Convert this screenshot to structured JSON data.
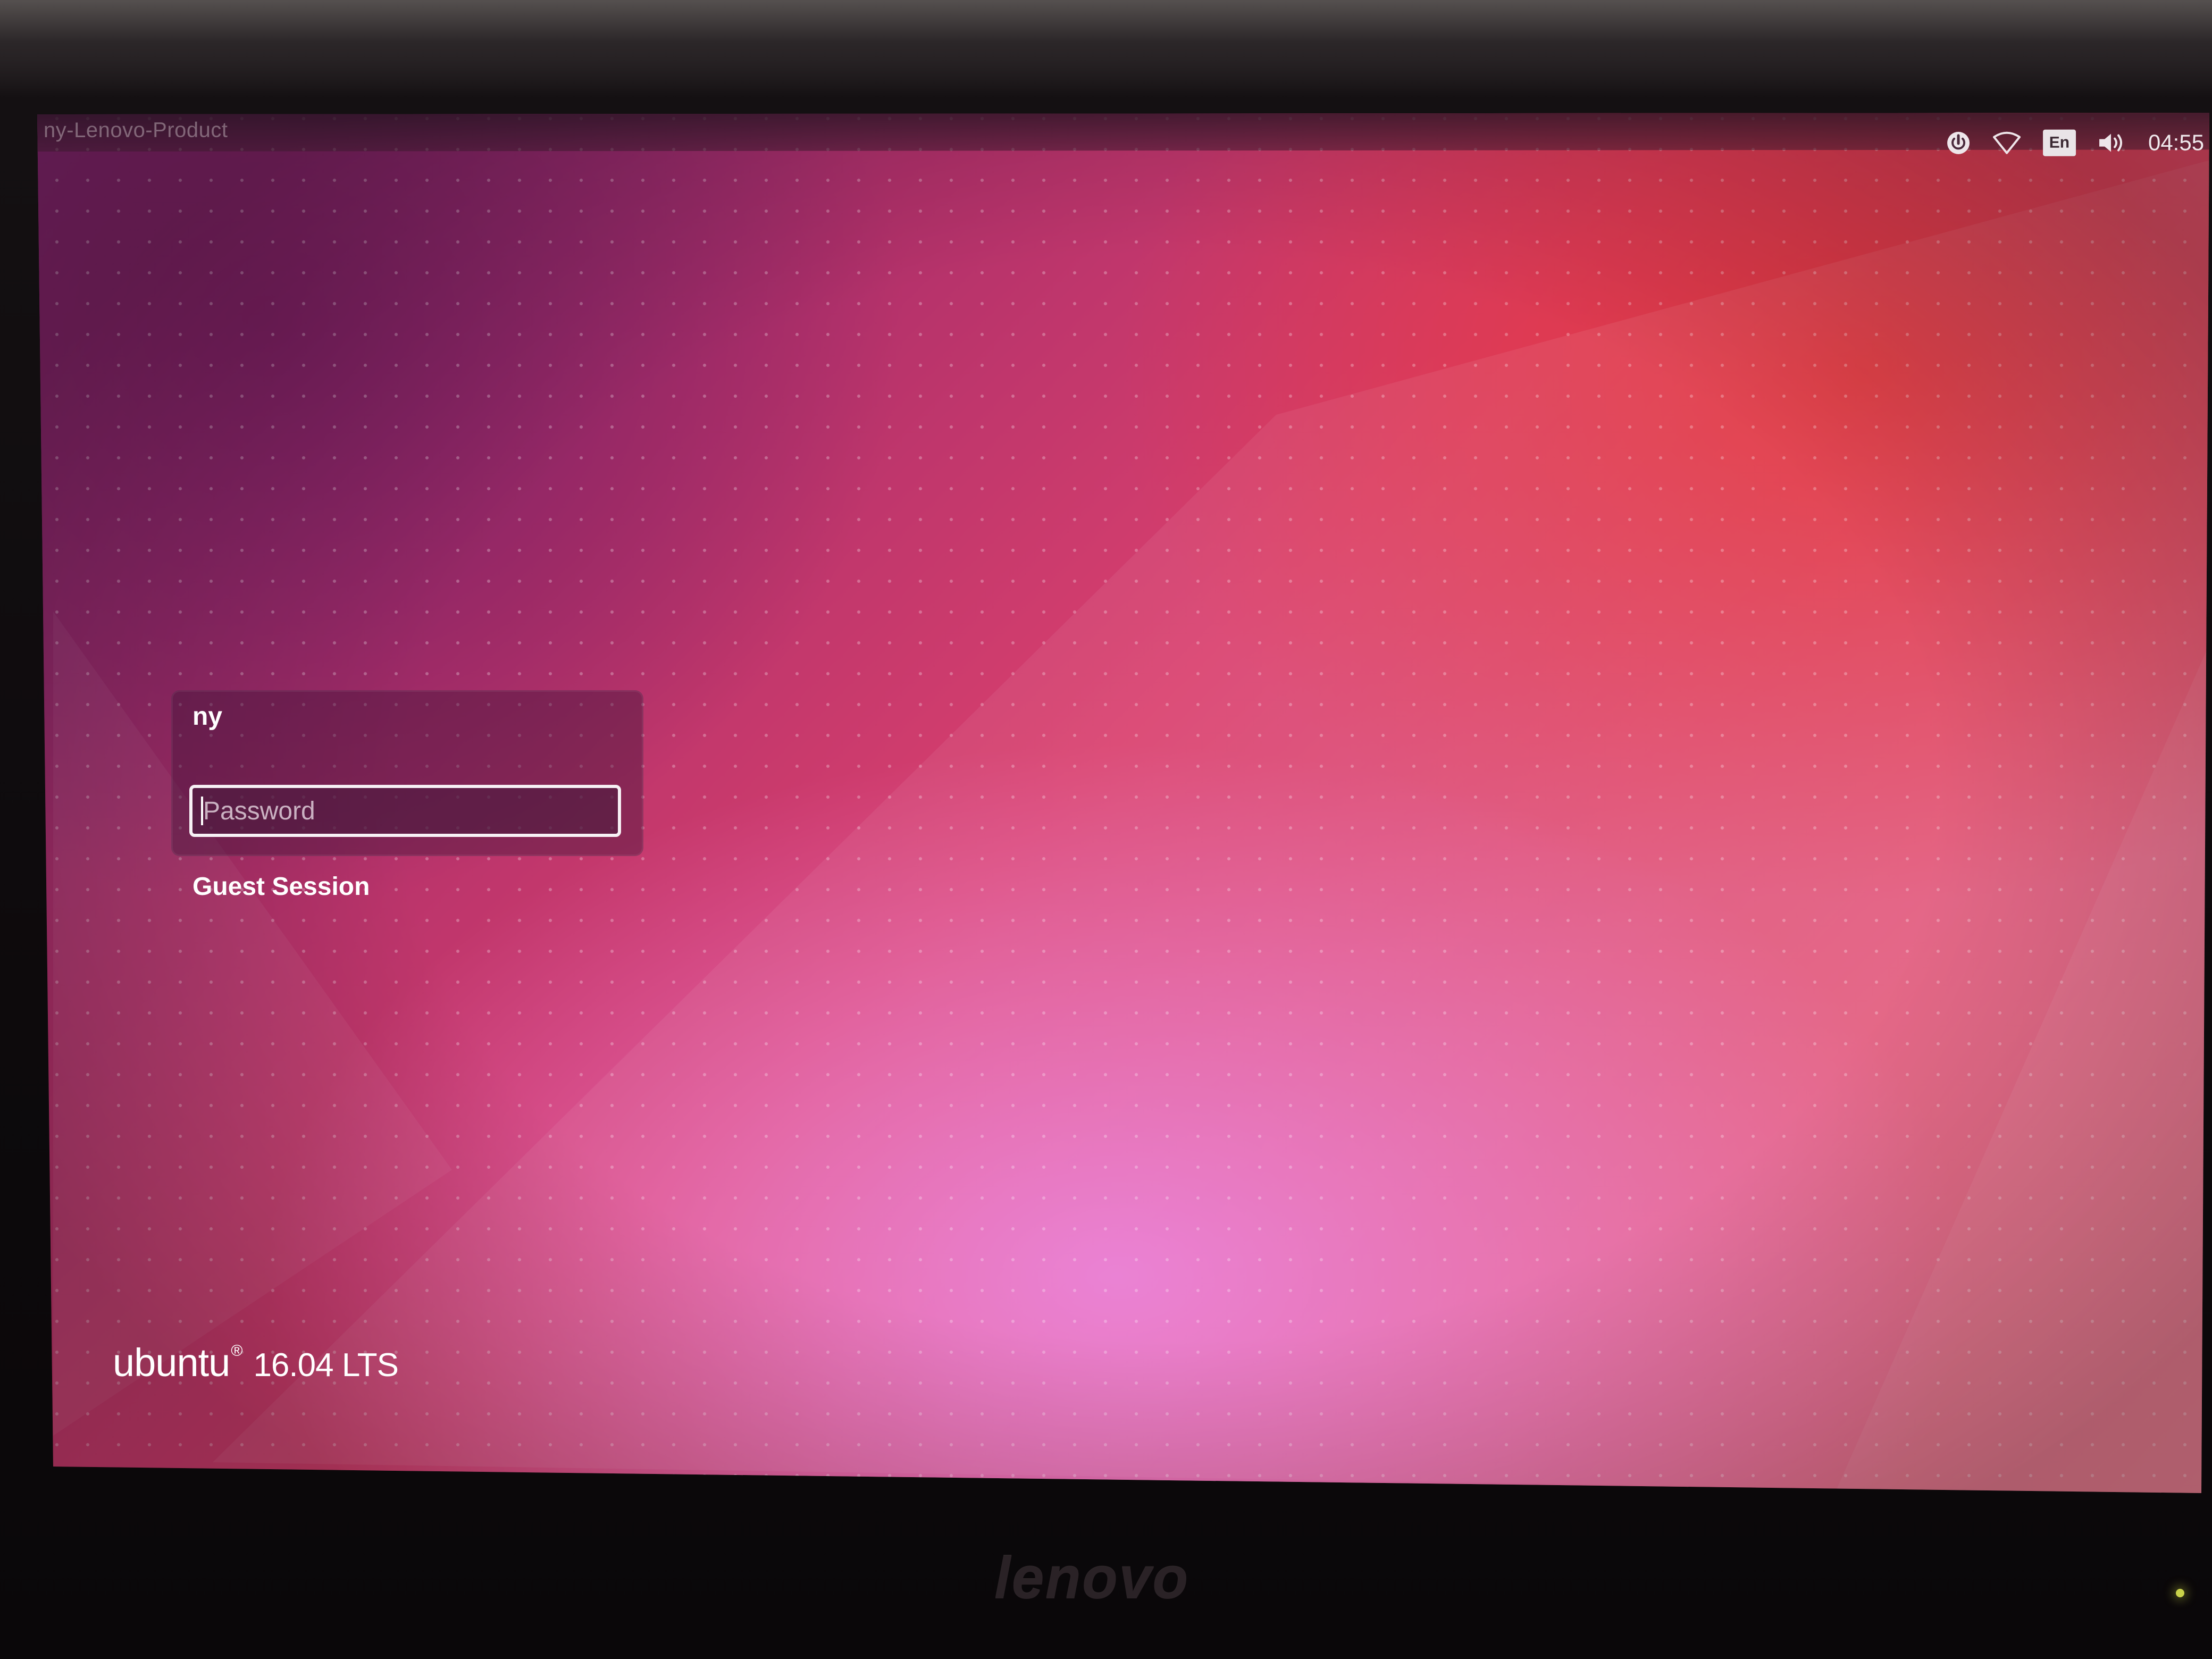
{
  "top_panel": {
    "hostname": "ny-Lenovo-Product",
    "indicators": [
      {
        "icon": "power-icon"
      },
      {
        "icon": "wifi-icon"
      },
      {
        "icon": "keyboard-layout-icon",
        "label": "En"
      },
      {
        "icon": "volume-icon"
      }
    ],
    "clock": "04:55"
  },
  "login": {
    "username": "ny",
    "password_placeholder": "Password",
    "password_value": "",
    "guest_session": "Guest Session"
  },
  "branding": {
    "name": "ubuntu",
    "registered_mark": "®",
    "version": "16.04 LTS"
  },
  "bezel": {
    "logo": "lenovo"
  },
  "colors": {
    "wallpaper_purple": "#7c2a78",
    "wallpaper_red": "#e2343a",
    "wallpaper_pink": "#eb82e1",
    "input_border": "#f7f1f5"
  }
}
